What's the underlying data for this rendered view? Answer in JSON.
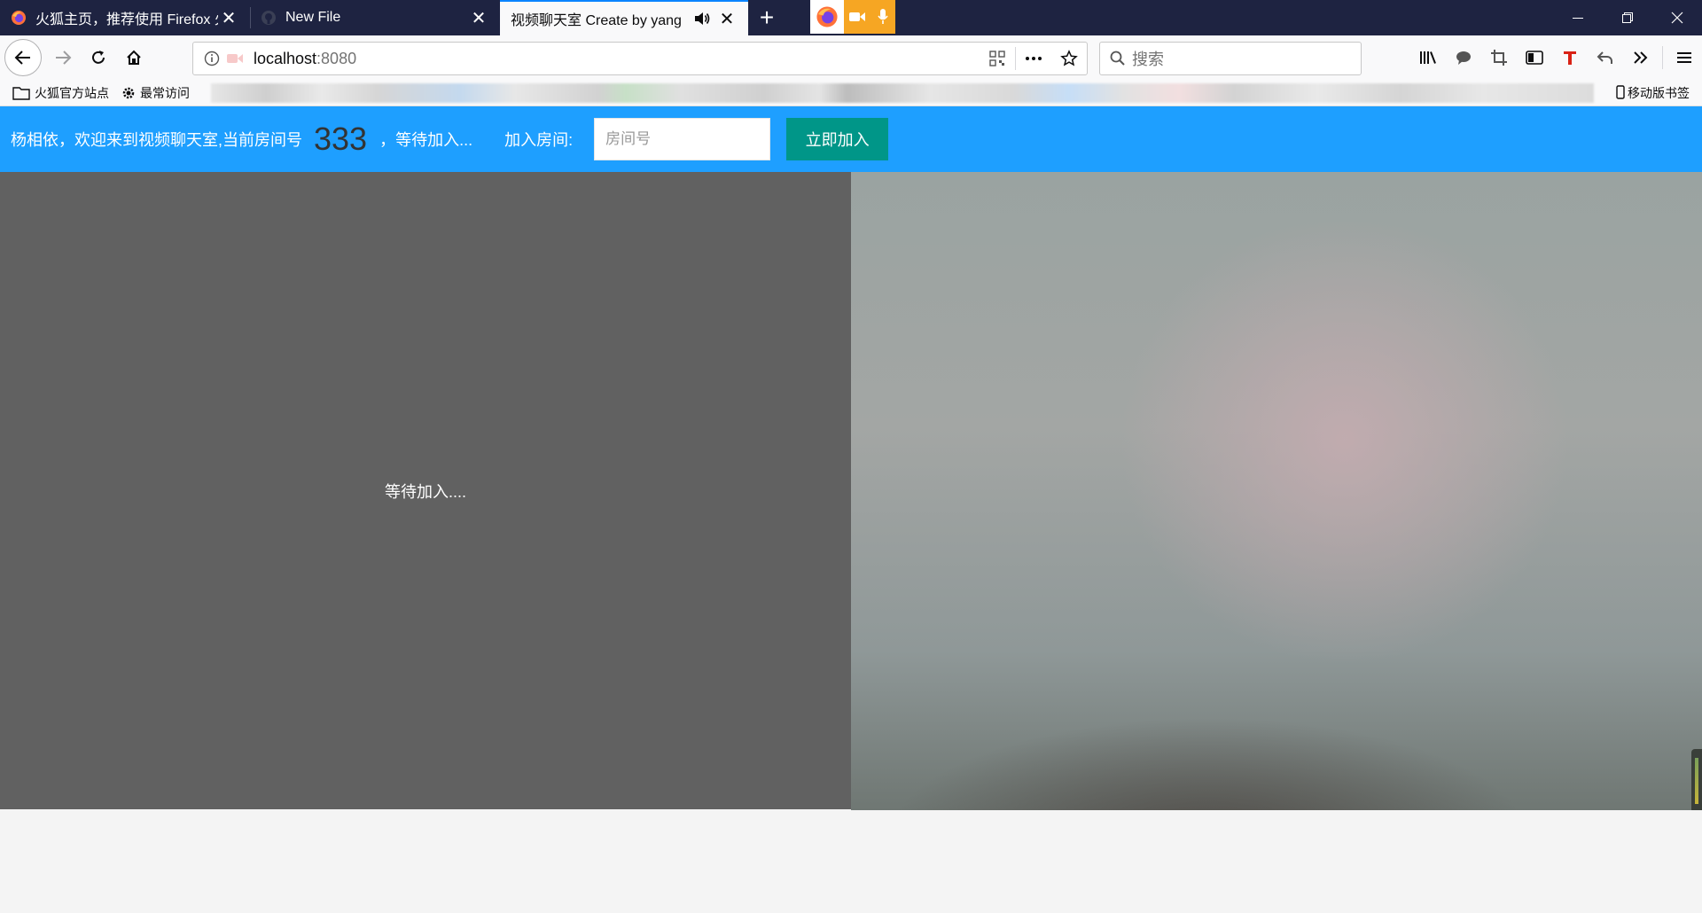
{
  "browser": {
    "tabs": [
      {
        "title": "火狐主页，推荐使用 Firefox 火",
        "icon": "firefox-icon",
        "active": false
      },
      {
        "title": "New File",
        "icon": "github-icon",
        "active": false
      },
      {
        "title": "视频聊天室 Create by yang",
        "icon": "none",
        "active": true,
        "audio": true
      }
    ],
    "close_glyph": "✕",
    "new_tab_glyph": "+",
    "url": {
      "host": "localhost",
      "port": ":8080"
    },
    "search_placeholder": "搜索",
    "bookmarks": [
      {
        "label": "火狐官方站点",
        "icon": "folder-icon"
      },
      {
        "label": "最常访问",
        "icon": "gear-icon"
      }
    ],
    "mobile_bookmarks": "移动版书签",
    "colors": {
      "titlebar": "#1e2341",
      "active_tab_accent": "#0a84ff",
      "sharing_indicator": "#f6a623"
    }
  },
  "app": {
    "welcome_text": "杨相依，欢迎来到视频聊天室,当前房间号",
    "room_number": "333",
    "waiting_status": "，等待加入...",
    "join_label": "加入房间:",
    "room_input_placeholder": "房间号",
    "room_input_value": "",
    "join_button": "立即加入",
    "remote_video_text": "等待加入....",
    "colors": {
      "header": "#1e9fff",
      "join_button": "#009688",
      "remote_video_bg": "#616161"
    }
  }
}
